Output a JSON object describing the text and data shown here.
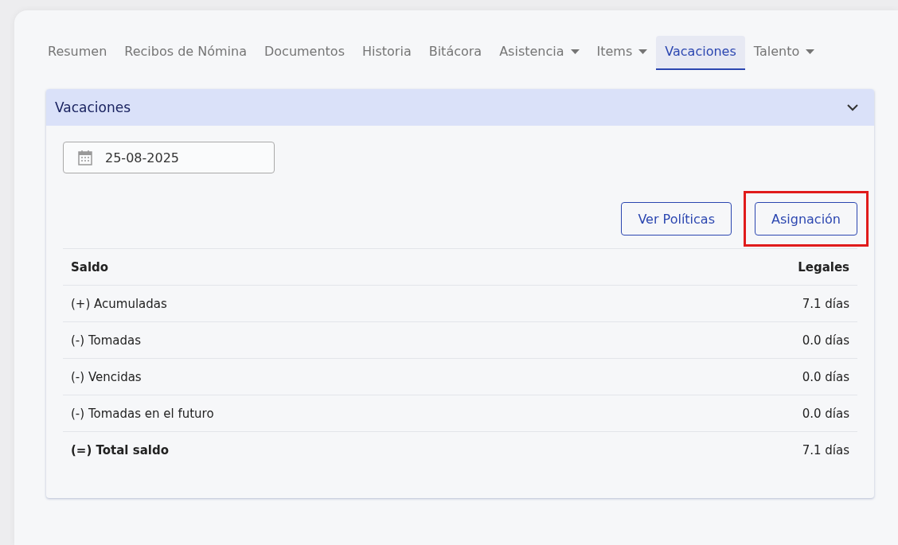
{
  "tabs": [
    {
      "label": "Resumen",
      "selected": false,
      "has_menu": false
    },
    {
      "label": "Recibos de Nómina",
      "selected": false,
      "has_menu": false
    },
    {
      "label": "Documentos",
      "selected": false,
      "has_menu": false
    },
    {
      "label": "Historia",
      "selected": false,
      "has_menu": false
    },
    {
      "label": "Bitácora",
      "selected": false,
      "has_menu": false
    },
    {
      "label": "Asistencia",
      "selected": false,
      "has_menu": true
    },
    {
      "label": "Items",
      "selected": false,
      "has_menu": true
    },
    {
      "label": "Vacaciones",
      "selected": true,
      "has_menu": false
    },
    {
      "label": "Talento",
      "selected": false,
      "has_menu": true
    }
  ],
  "panel": {
    "title": "Vacaciones",
    "expanded": true,
    "date_field": {
      "value": "25-08-2025"
    },
    "buttons": [
      {
        "label": "Ver Políticas",
        "highlighted": false
      },
      {
        "label": "Asignación",
        "highlighted": true
      }
    ],
    "table": {
      "columns": [
        "Saldo",
        "Legales"
      ],
      "rows": [
        {
          "kind": "item",
          "cells": [
            "(+) Acumuladas",
            "7.1 días"
          ]
        },
        {
          "kind": "item",
          "cells": [
            "(-) Tomadas",
            "0.0 días"
          ]
        },
        {
          "kind": "item",
          "cells": [
            "(-) Vencidas",
            "0.0 días"
          ]
        },
        {
          "kind": "item",
          "cells": [
            "(-) Tomadas en el futuro",
            "0.0 días"
          ]
        },
        {
          "kind": "total",
          "cells": [
            "(=) Total saldo",
            "7.1 días"
          ]
        }
      ]
    }
  }
}
